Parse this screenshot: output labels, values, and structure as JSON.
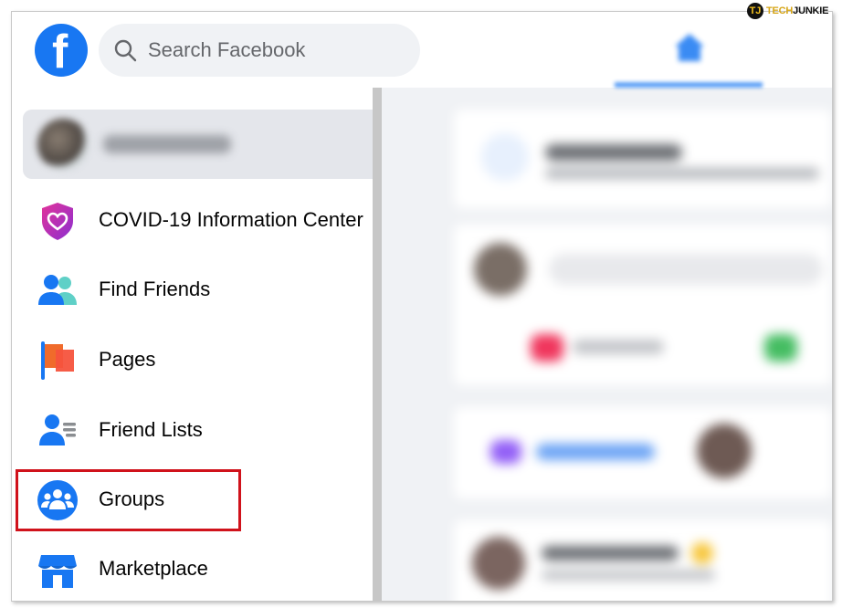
{
  "search": {
    "placeholder": "Search Facebook"
  },
  "sidebar": {
    "items": [
      {
        "label": "COVID-19 Information Center",
        "icon": "covid-heart-shield-icon"
      },
      {
        "label": "Find Friends",
        "icon": "friends-icon"
      },
      {
        "label": "Pages",
        "icon": "flag-icon"
      },
      {
        "label": "Friend Lists",
        "icon": "friend-list-icon"
      },
      {
        "label": "Groups",
        "icon": "groups-icon"
      },
      {
        "label": "Marketplace",
        "icon": "shop-icon"
      }
    ]
  },
  "watermark": {
    "prefix": "TECH",
    "suffix": "JUNKIE",
    "badge": "TJ"
  },
  "colors": {
    "brand": "#1877f2",
    "highlight": "#d0121b",
    "sidebar_active": "#e4e6eb",
    "page_bg": "#f0f2f5"
  }
}
